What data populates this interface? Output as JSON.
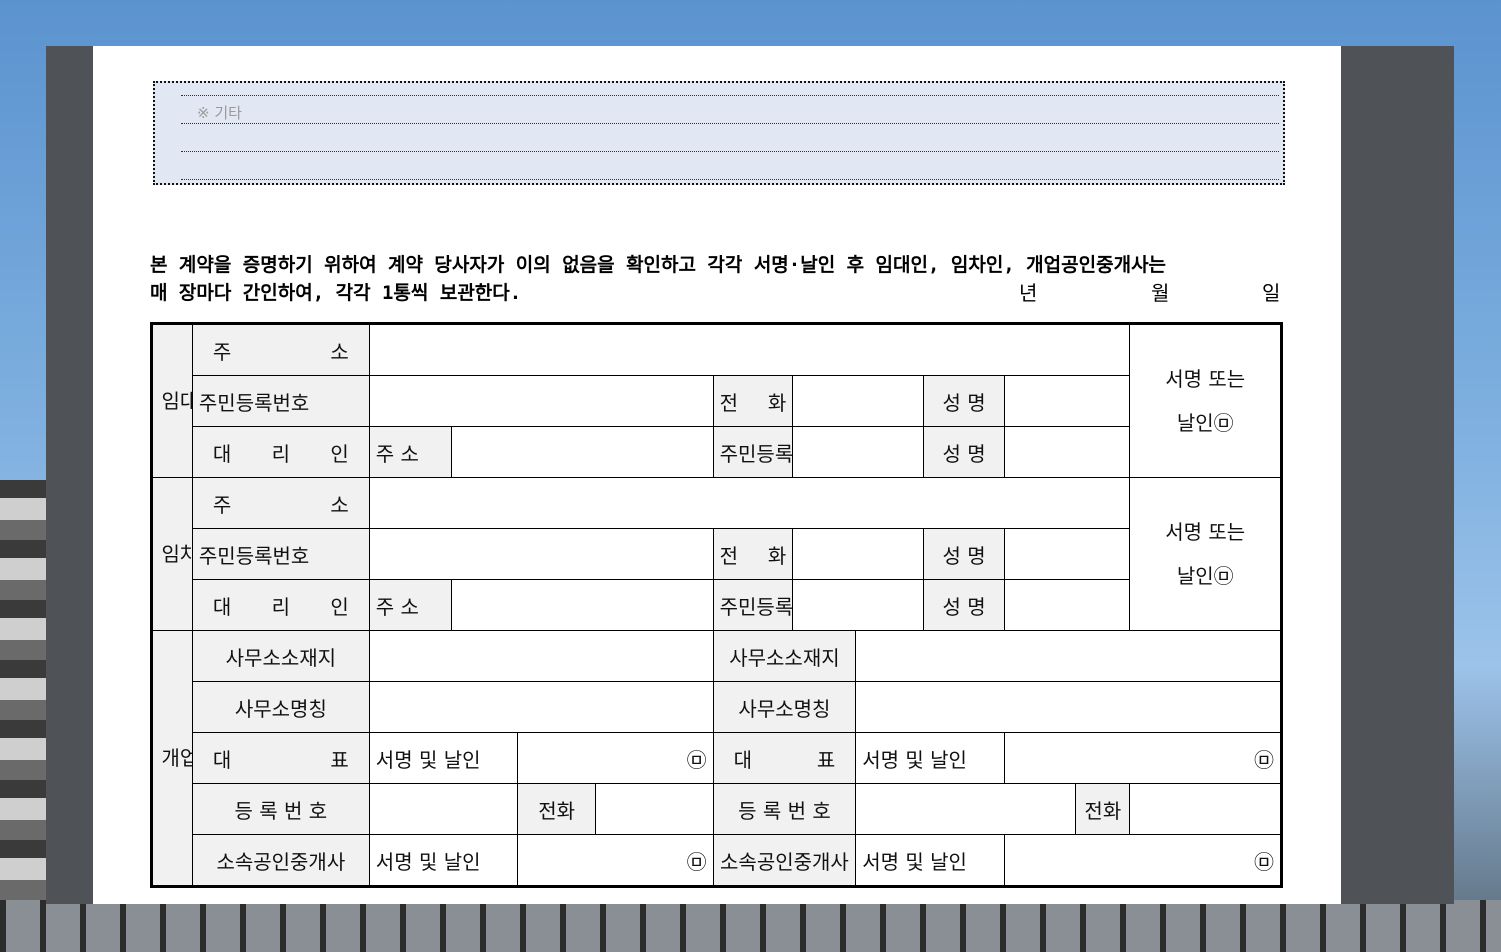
{
  "other_section": {
    "label": "※ 기타"
  },
  "statement": {
    "line1": "본 계약을 증명하기 위하여 계약 당사자가 이의 없음을 확인하고 각각 서명·날인 후 임대인, 임차인, 개업공인중개사는",
    "line2": "매 장마다 간인하여, 각각 1통씩 보관한다.",
    "year": "년",
    "month": "월",
    "day": "일"
  },
  "lessor": {
    "group_label": "임대인",
    "address_label": [
      "주",
      "소"
    ],
    "id_label": "주민등록번호",
    "phone_label": [
      "전",
      "화"
    ],
    "name_label": "성 명",
    "agent_label": [
      "대",
      "리",
      "인"
    ],
    "agent_address_label": "주 소",
    "agent_id_label": "주민등록번호",
    "agent_name_label": "성 명",
    "sign_line1": "서명 또는",
    "sign_line2": "날인㉤"
  },
  "lessee": {
    "group_label": "임차인",
    "address_label": [
      "주",
      "소"
    ],
    "id_label": "주민등록번호",
    "phone_label": [
      "전",
      "화"
    ],
    "name_label": "성 명",
    "agent_label": [
      "대",
      "리",
      "인"
    ],
    "agent_address_label": "주 소",
    "agent_id_label": "주민등록번호",
    "agent_name_label": "성 명",
    "sign_line1": "서명 또는",
    "sign_line2": "날인㉤"
  },
  "broker": {
    "group_label": "개업공인중개사",
    "office_location_label": "사무소소재지",
    "office_name_label": "사무소명칭",
    "representative_label": [
      "대",
      "표"
    ],
    "sign_seal_label": "서명 및 날인",
    "seal_mark": "㉤",
    "registration_label": "등 록 번 호",
    "phone_label": "전화",
    "affiliated_label": "소속공인중개사"
  }
}
